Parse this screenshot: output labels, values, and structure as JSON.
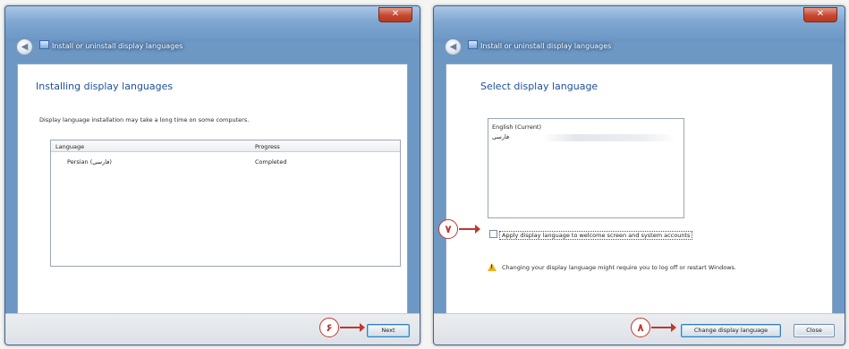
{
  "left_window": {
    "nav_title": "Install or uninstall display languages",
    "close_glyph": "✕",
    "back_glyph": "◀",
    "heading": "Installing display languages",
    "description": "Display language installation may take a long time on some computers.",
    "table": {
      "columns": [
        "Language",
        "Progress"
      ],
      "rows": [
        {
          "language": "Persian (فارسی)",
          "progress": "Completed"
        }
      ]
    },
    "next_button": "Next",
    "marker": "۶"
  },
  "right_window": {
    "nav_title": "Install or uninstall display languages",
    "close_glyph": "✕",
    "back_glyph": "◀",
    "heading": "Select display language",
    "languages": [
      "English (Current)",
      "فارسی"
    ],
    "checkbox_label": "Apply display language to welcome screen and system accounts",
    "checkbox_marker": "۷",
    "warning_text": "Changing your display language might require you to log off or restart Windows.",
    "warning_icon": "warning-icon",
    "change_button": "Change display language",
    "close_button": "Close",
    "change_marker": "۸"
  },
  "colors": {
    "title_blue": "#6d98c4",
    "heading_blue": "#1e4f9a",
    "marker_red": "#c0372e",
    "close_red": "#c7482f"
  }
}
